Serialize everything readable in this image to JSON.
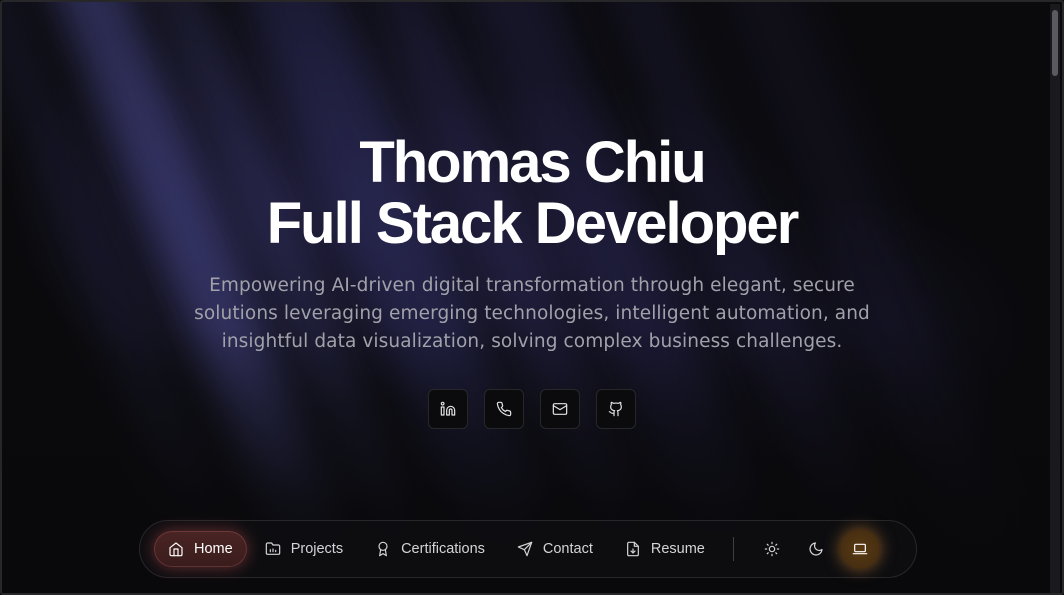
{
  "hero": {
    "name": "Thomas Chiu",
    "role": "Full Stack Developer",
    "tagline": "Empowering AI-driven digital transformation through elegant, secure solutions leveraging emerging technologies, intelligent automation, and insightful data visualization, solving complex business challenges."
  },
  "socials": [
    {
      "icon": "linkedin-icon"
    },
    {
      "icon": "phone-icon"
    },
    {
      "icon": "mail-icon"
    },
    {
      "icon": "github-icon"
    }
  ],
  "nav": {
    "items": [
      {
        "label": "Home",
        "icon": "home-icon",
        "active": true
      },
      {
        "label": "Projects",
        "icon": "folder-icon",
        "active": false
      },
      {
        "label": "Certifications",
        "icon": "award-icon",
        "active": false
      },
      {
        "label": "Contact",
        "icon": "send-icon",
        "active": false
      },
      {
        "label": "Resume",
        "icon": "file-download-icon",
        "active": false
      }
    ],
    "theme_modes": [
      {
        "icon": "sun-icon",
        "active": false
      },
      {
        "icon": "moon-icon",
        "active": false
      },
      {
        "icon": "laptop-icon",
        "active": true
      }
    ]
  },
  "colors": {
    "background": "#09090b",
    "active_nav": "#4a2424",
    "active_mode": "#5a3b14",
    "muted_text": "#a1a1aa"
  }
}
